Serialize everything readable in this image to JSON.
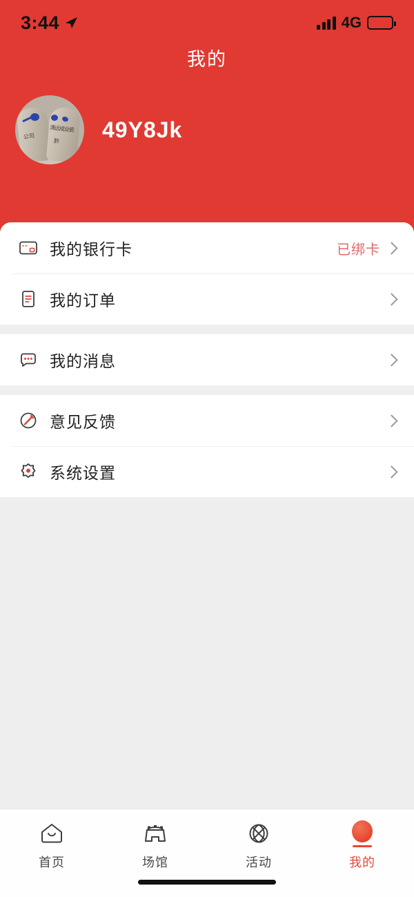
{
  "statusbar": {
    "time": "3:44",
    "location_icon": "location-arrow-icon",
    "signal_icon": "signal-bars-icon",
    "network": "4G",
    "battery_icon": "battery-full-icon"
  },
  "header": {
    "title": "我的",
    "background_color": "#e03a33",
    "profile": {
      "avatar_icon": "user-avatar-photo",
      "username": "49Y8Jk"
    }
  },
  "menu": {
    "groups": [
      {
        "items": [
          {
            "icon": "bank-card-icon",
            "label": "我的银行卡",
            "value": "已绑卡",
            "value_color": "#df6a6a",
            "chevron": "chevron-right-icon"
          },
          {
            "icon": "order-list-icon",
            "label": "我的订单",
            "value": "",
            "chevron": "chevron-right-icon"
          }
        ]
      },
      {
        "items": [
          {
            "icon": "message-bubble-icon",
            "label": "我的消息",
            "value": "",
            "chevron": "chevron-right-icon"
          }
        ]
      },
      {
        "items": [
          {
            "icon": "feedback-pencil-icon",
            "label": "意见反馈",
            "value": "",
            "chevron": "chevron-right-icon"
          },
          {
            "icon": "settings-gear-icon",
            "label": "系统设置",
            "value": "",
            "chevron": "chevron-right-icon"
          }
        ]
      }
    ]
  },
  "tabbar": {
    "active_color": "#e04a3a",
    "inactive_color": "#4a4a4a",
    "tabs": [
      {
        "icon": "home-house-icon",
        "label": "首页",
        "active": false
      },
      {
        "icon": "venue-stadium-icon",
        "label": "场馆",
        "active": false
      },
      {
        "icon": "activity-basketball-icon",
        "label": "活动",
        "active": false
      },
      {
        "icon": "mine-person-icon",
        "label": "我的",
        "active": true
      }
    ]
  }
}
